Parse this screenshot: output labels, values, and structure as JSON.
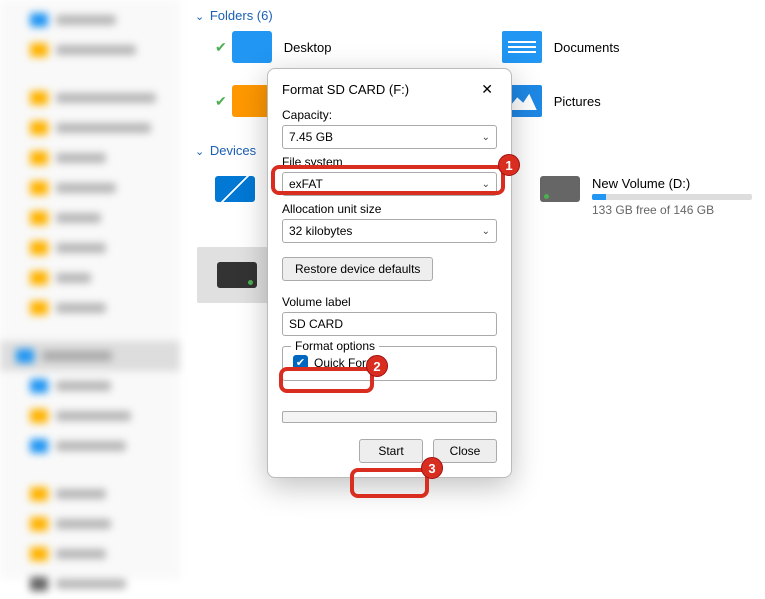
{
  "sections": {
    "folders_header": "Folders (6)",
    "devices_header": "Devices"
  },
  "folders": {
    "desktop": "Desktop",
    "documents": "Documents",
    "pictures": "Pictures"
  },
  "drives": {
    "new_volume_name": "New Volume (D:)",
    "new_volume_free": "133 GB free of 146 GB",
    "new_volume_pct": 9
  },
  "dialog": {
    "title": "Format SD CARD (F:)",
    "capacity_label": "Capacity:",
    "capacity_value": "7.45 GB",
    "fs_label": "File system",
    "fs_value": "exFAT",
    "au_label": "Allocation unit size",
    "au_value": "32 kilobytes",
    "restore_btn": "Restore device defaults",
    "vol_label": "Volume label",
    "vol_value": "SD CARD",
    "fmt_options_legend": "Format options",
    "quick_format_label": "Quick Format",
    "quick_format_checked": true,
    "start_btn": "Start",
    "close_btn": "Close"
  },
  "annotations": {
    "b1": "1",
    "b2": "2",
    "b3": "3"
  }
}
